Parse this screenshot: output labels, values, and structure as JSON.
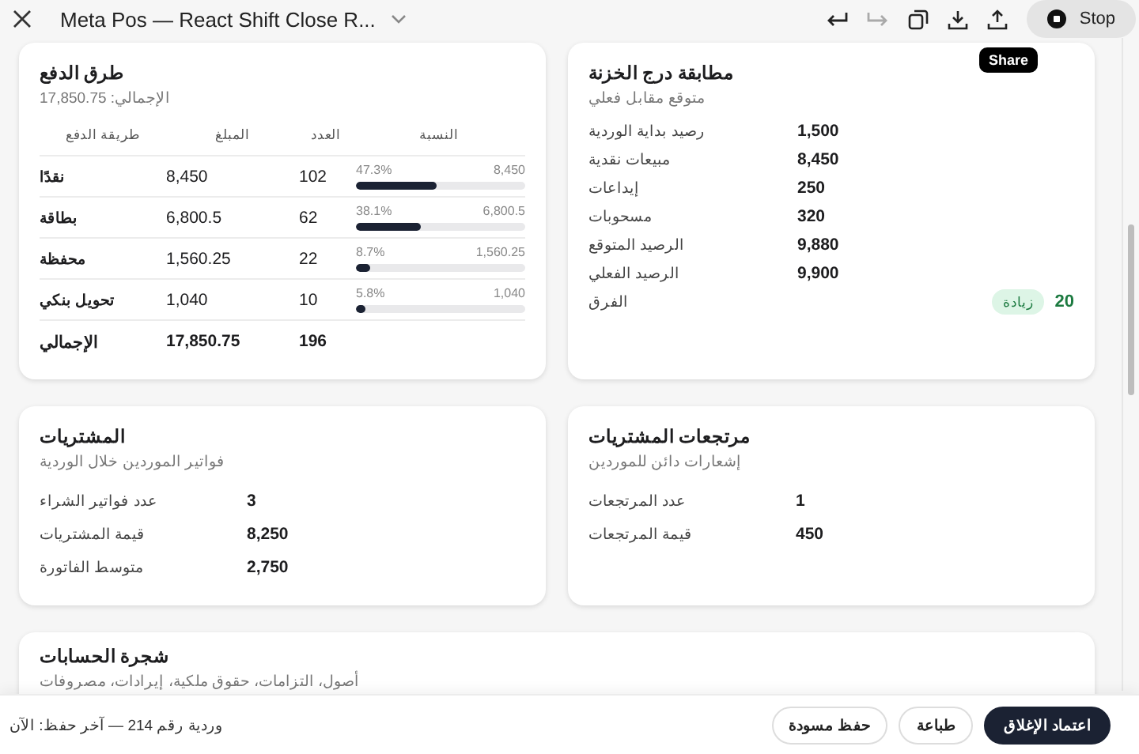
{
  "window": {
    "title": "Meta Pos — React Shift Close R...",
    "stop_label": "Stop",
    "tooltip": "Share"
  },
  "payments": {
    "title": "طرق الدفع",
    "subtitle": "الإجمالي: 17,850.75",
    "columns": [
      "النسبة",
      "العدد",
      "المبلغ",
      "طريقة الدفع"
    ],
    "rows": [
      {
        "method": "نقدًا",
        "amount": "8,450",
        "count": "102",
        "percent": "47.3%",
        "bar_amount": "8,450",
        "level": 0.473
      },
      {
        "method": "بطاقة",
        "amount": "6,800.5",
        "count": "62",
        "percent": "38.1%",
        "bar_amount": "6,800.5",
        "level": 0.381
      },
      {
        "method": "محفظة",
        "amount": "1,560.25",
        "count": "22",
        "percent": "8.7%",
        "bar_amount": "1,560.25",
        "level": 0.087
      },
      {
        "method": "تحويل بنكي",
        "amount": "1,040",
        "count": "10",
        "percent": "5.8%",
        "bar_amount": "1,040",
        "level": 0.058
      }
    ],
    "total": {
      "method": "الإجمالي",
      "amount": "17,850.75",
      "count": "196"
    }
  },
  "drawer": {
    "title": "مطابقة درج الخزنة",
    "subtitle": "متوقع مقابل فعلي",
    "rows": [
      {
        "label": "رصيد بداية الوردية",
        "value": "1,500"
      },
      {
        "label": "مبيعات نقدية",
        "value": "8,450"
      },
      {
        "label": "إيداعات",
        "value": "250"
      },
      {
        "label": "مسحوبات",
        "value": "320"
      },
      {
        "label": "الرصيد المتوقع",
        "value": "9,880"
      },
      {
        "label": "الرصيد الفعلي",
        "value": "9,900"
      }
    ],
    "difference": {
      "label": "الفرق",
      "badge": "زيادة",
      "value": "20",
      "kind": "surplus"
    }
  },
  "purchases": {
    "title": "المشتريات",
    "subtitle": "فواتير الموردين خلال الوردية",
    "rows": [
      {
        "label": "عدد فواتير الشراء",
        "value": "3"
      },
      {
        "label": "قيمة المشتريات",
        "value": "8,250"
      },
      {
        "label": "متوسط الفاتورة",
        "value": "2,750"
      }
    ]
  },
  "purchase_returns": {
    "title": "مرتجعات المشتريات",
    "subtitle": "إشعارات دائن للموردين",
    "rows": [
      {
        "label": "عدد المرتجعات",
        "value": "1"
      },
      {
        "label": "قيمة المرتجعات",
        "value": "450"
      }
    ]
  },
  "accounts": {
    "title": "شجرة الحسابات",
    "subtitle": "أصول، التزامات، حقوق ملكية، إيرادات، مصروفات"
  },
  "footer": {
    "status": "وردية رقم 214 — آخر حفظ: الآن",
    "buttons": [
      {
        "label": "اعتماد الإغلاق",
        "kind": "primary"
      },
      {
        "label": "طباعة",
        "kind": "secondary"
      },
      {
        "label": "حفظ مسودة",
        "kind": "secondary"
      }
    ]
  }
}
